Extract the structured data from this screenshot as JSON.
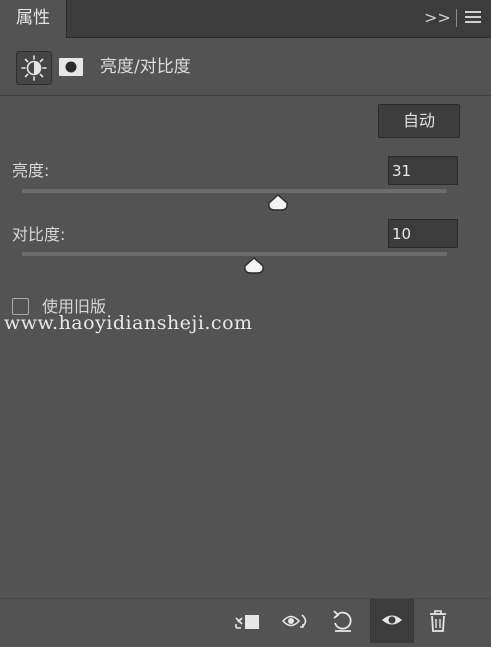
{
  "panel": {
    "tab_label": "属性",
    "collapse_glyph": ">>"
  },
  "adjustment": {
    "title": "亮度/对比度",
    "auto_button": "自动"
  },
  "controls": {
    "brightness": {
      "label": "亮度:",
      "value": "31"
    },
    "contrast": {
      "label": "对比度:",
      "value": "10"
    }
  },
  "legacy": {
    "label": "使用旧版",
    "checked": false
  },
  "watermark": "www.haoyidiansheji.com",
  "toolbar": {
    "icons": [
      "clip-to-layer-icon",
      "view-previous-state-icon",
      "reset-icon",
      "visibility-eye-icon",
      "trash-icon"
    ]
  },
  "colors": {
    "panel_bg": "#535353",
    "header_bg": "#3c3c3c",
    "field_bg": "#3c3c3c"
  }
}
